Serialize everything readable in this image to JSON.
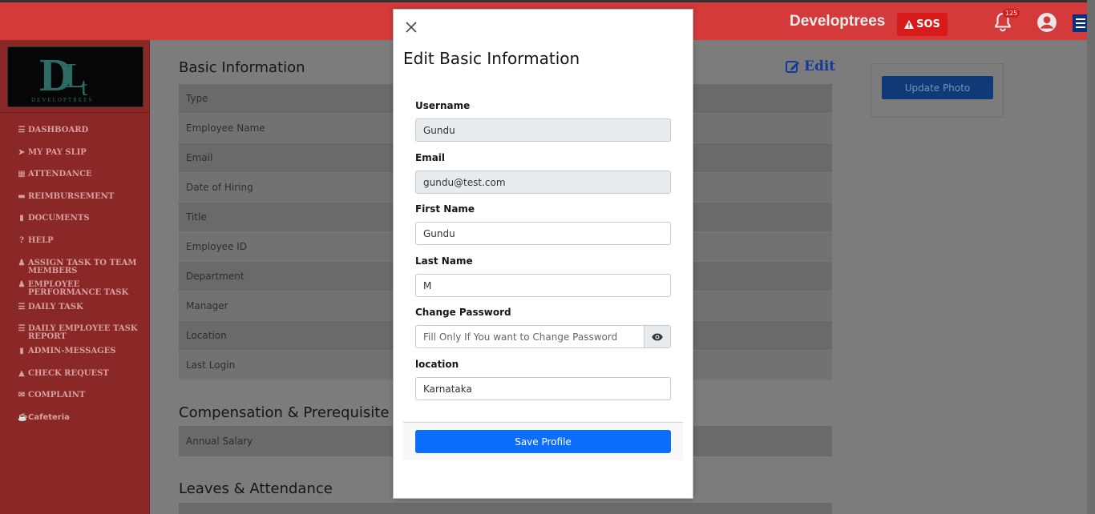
{
  "header": {
    "brand": "Developtrees",
    "sos_label": "SOS",
    "notification_count": "125"
  },
  "sidebar": {
    "logo_text": "DEVELOPTREES",
    "items": [
      {
        "label": "DASHBOARD",
        "icon": "bars-icon"
      },
      {
        "label": "MY PAY SLIP",
        "icon": "paper-plane-icon"
      },
      {
        "label": "ATTENDANCE",
        "icon": "calendar-icon"
      },
      {
        "label": "REIMBURSEMENT",
        "icon": "credit-card-icon"
      },
      {
        "label": "DOCUMENTS",
        "icon": "file-icon"
      },
      {
        "label": "HELP",
        "icon": "question-circle-icon"
      },
      {
        "label": "ASSIGN TASK TO TEAM MEMBERS",
        "icon": "users-icon"
      },
      {
        "label": "EMPLOYEE PERFORMANCE TASK",
        "icon": "user-edit-icon"
      },
      {
        "label": "DAILY TASK",
        "icon": "list-icon"
      },
      {
        "label": "DAILY EMPLOYEE TASK REPORT",
        "icon": "list-icon"
      },
      {
        "label": "ADMIN-MESSAGES",
        "icon": "file-icon"
      },
      {
        "label": "CHECK REQUEST",
        "icon": "bell-icon"
      },
      {
        "label": "COMPLAINT",
        "icon": "envelope-icon"
      },
      {
        "label": "Cafeteria",
        "icon": "coffee-icon"
      }
    ]
  },
  "main": {
    "basic_info_title": "Basic Information",
    "edit_label": "Edit",
    "basic_rows": [
      "Type",
      "Employee Name",
      "Email",
      "Date of Hiring",
      "Title",
      "Employee ID",
      "Department",
      "Manager",
      "Location",
      "Last Login"
    ],
    "compensation_title": "Compensation & Prerequisite",
    "compensation_rows": [
      "Annual Salary"
    ],
    "leaves_title": "Leaves & Attendance",
    "update_photo_label": "Update Photo"
  },
  "modal": {
    "title": "Edit Basic Information",
    "fields": {
      "username": {
        "label": "Username",
        "value": "Gundu"
      },
      "email": {
        "label": "Email",
        "value": "gundu@test.com"
      },
      "first_name": {
        "label": "First Name",
        "value": "Gundu"
      },
      "last_name": {
        "label": "Last Name",
        "value": "M"
      },
      "password": {
        "label": "Change Password",
        "placeholder": "Fill Only If You want to Change Password"
      },
      "location": {
        "label": "location",
        "value": "Karnataka"
      }
    },
    "save_label": "Save Profile"
  },
  "colors": {
    "header_red": "#d43a3a",
    "sidebar_red": "#8a2727",
    "primary_blue": "#0d6efd"
  }
}
